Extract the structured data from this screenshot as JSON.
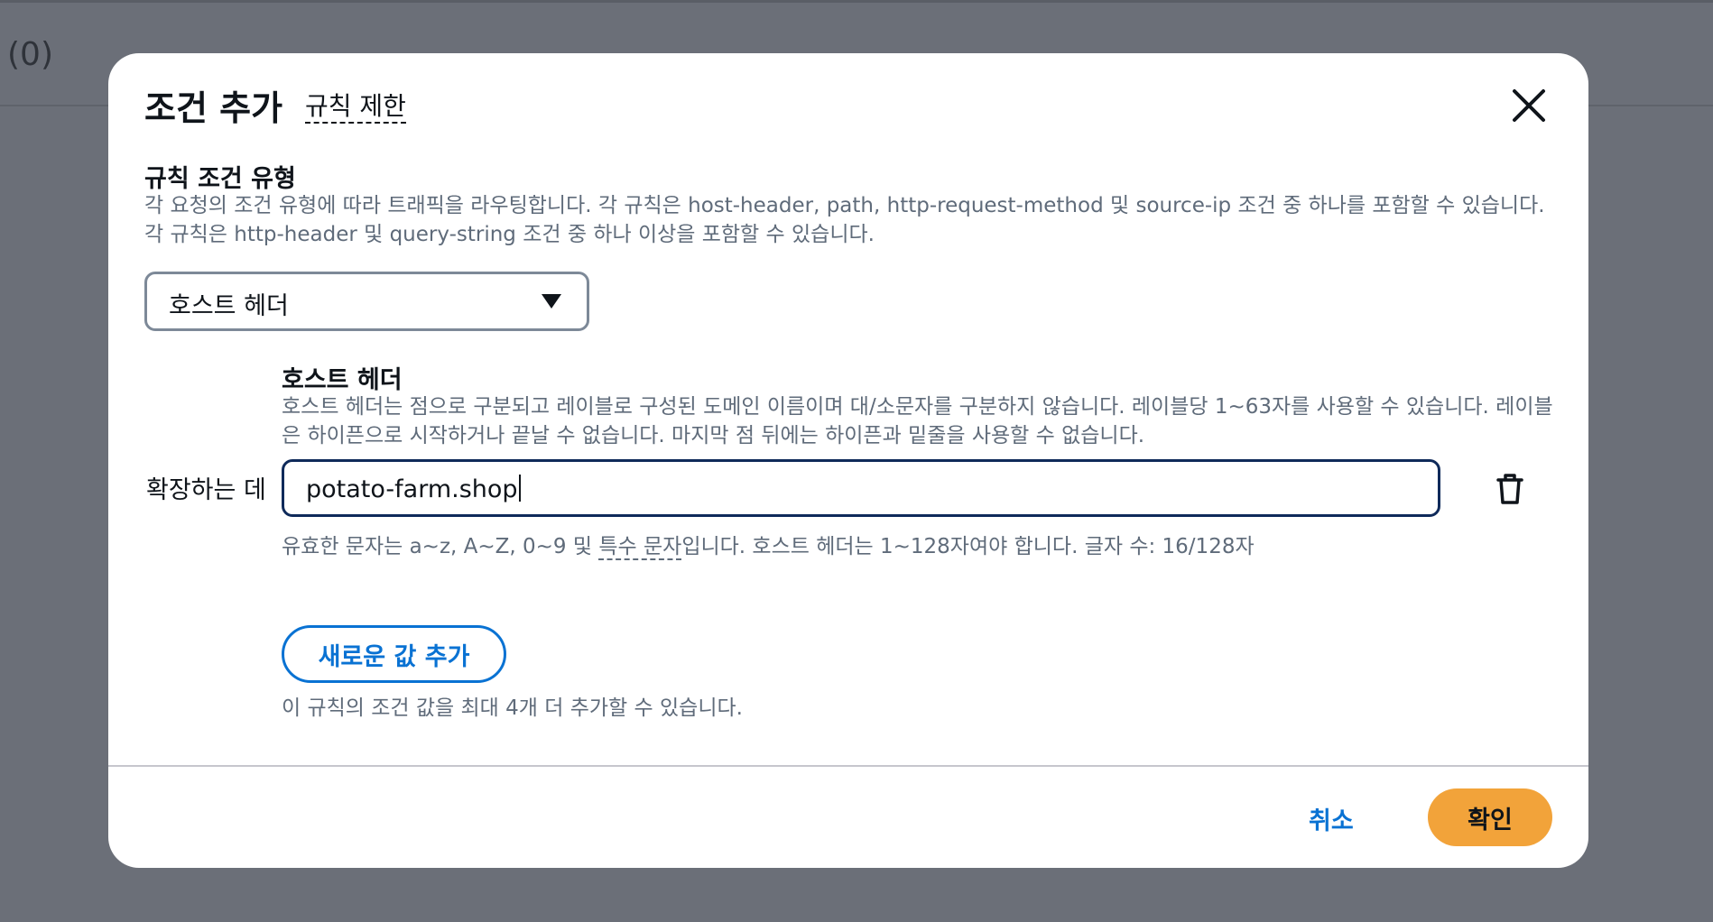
{
  "background": {
    "count_text": "(0)"
  },
  "modal": {
    "title": "조건 추가",
    "info_link": "규칙 제한",
    "close_icon": "close-icon"
  },
  "rule_condition_type": {
    "label": "규칙 조건 유형",
    "description": "각 요청의 조건 유형에 따라 트래픽을 라우팅합니다. 각 규칙은 host-header, path, http-request-method 및 source-ip 조건 중 하나를 포함할 수 있습니다. 각 규칙은 http-header 및 query-string 조건 중 하나 이상을 포함할 수 있습니다.",
    "selected": "호스트 헤더",
    "caret_icon": "caret-down-icon"
  },
  "host_header": {
    "label": "호스트 헤더",
    "description": "호스트 헤더는 점으로 구분되고 레이블로 구성된 도메인 이름이며 대/소문자를 구분하지 않습니다. 레이블당 1~63자를 사용할 수 있습니다. 레이블은 하이픈으로 시작하거나 끝날 수 없습니다. 마지막 점 뒤에는 하이픈과 밑줄을 사용할 수 없습니다.",
    "row_label": "확장하는 데",
    "value": "potato-farm.shop",
    "delete_icon": "trash-icon",
    "constraint_prefix": "유효한 문자는 a~z, A~Z, 0~9 및 ",
    "constraint_link": "특수 문자",
    "constraint_suffix": "입니다. 호스트 헤더는 1~128자여야 합니다. 글자 수: 16/128자"
  },
  "add_value": {
    "button_label": "새로운 값 추가",
    "hint": "이 규칙의 조건 값을 최대 4개 더 추가할 수 있습니다."
  },
  "footer": {
    "cancel_label": "취소",
    "confirm_label": "확인"
  },
  "colors": {
    "backdrop": "#6b6f78",
    "link_blue": "#0972d3",
    "primary_orange": "#f2a33a",
    "input_focus_border": "#0f2a5a",
    "secondary_text": "#5f6b7a"
  }
}
